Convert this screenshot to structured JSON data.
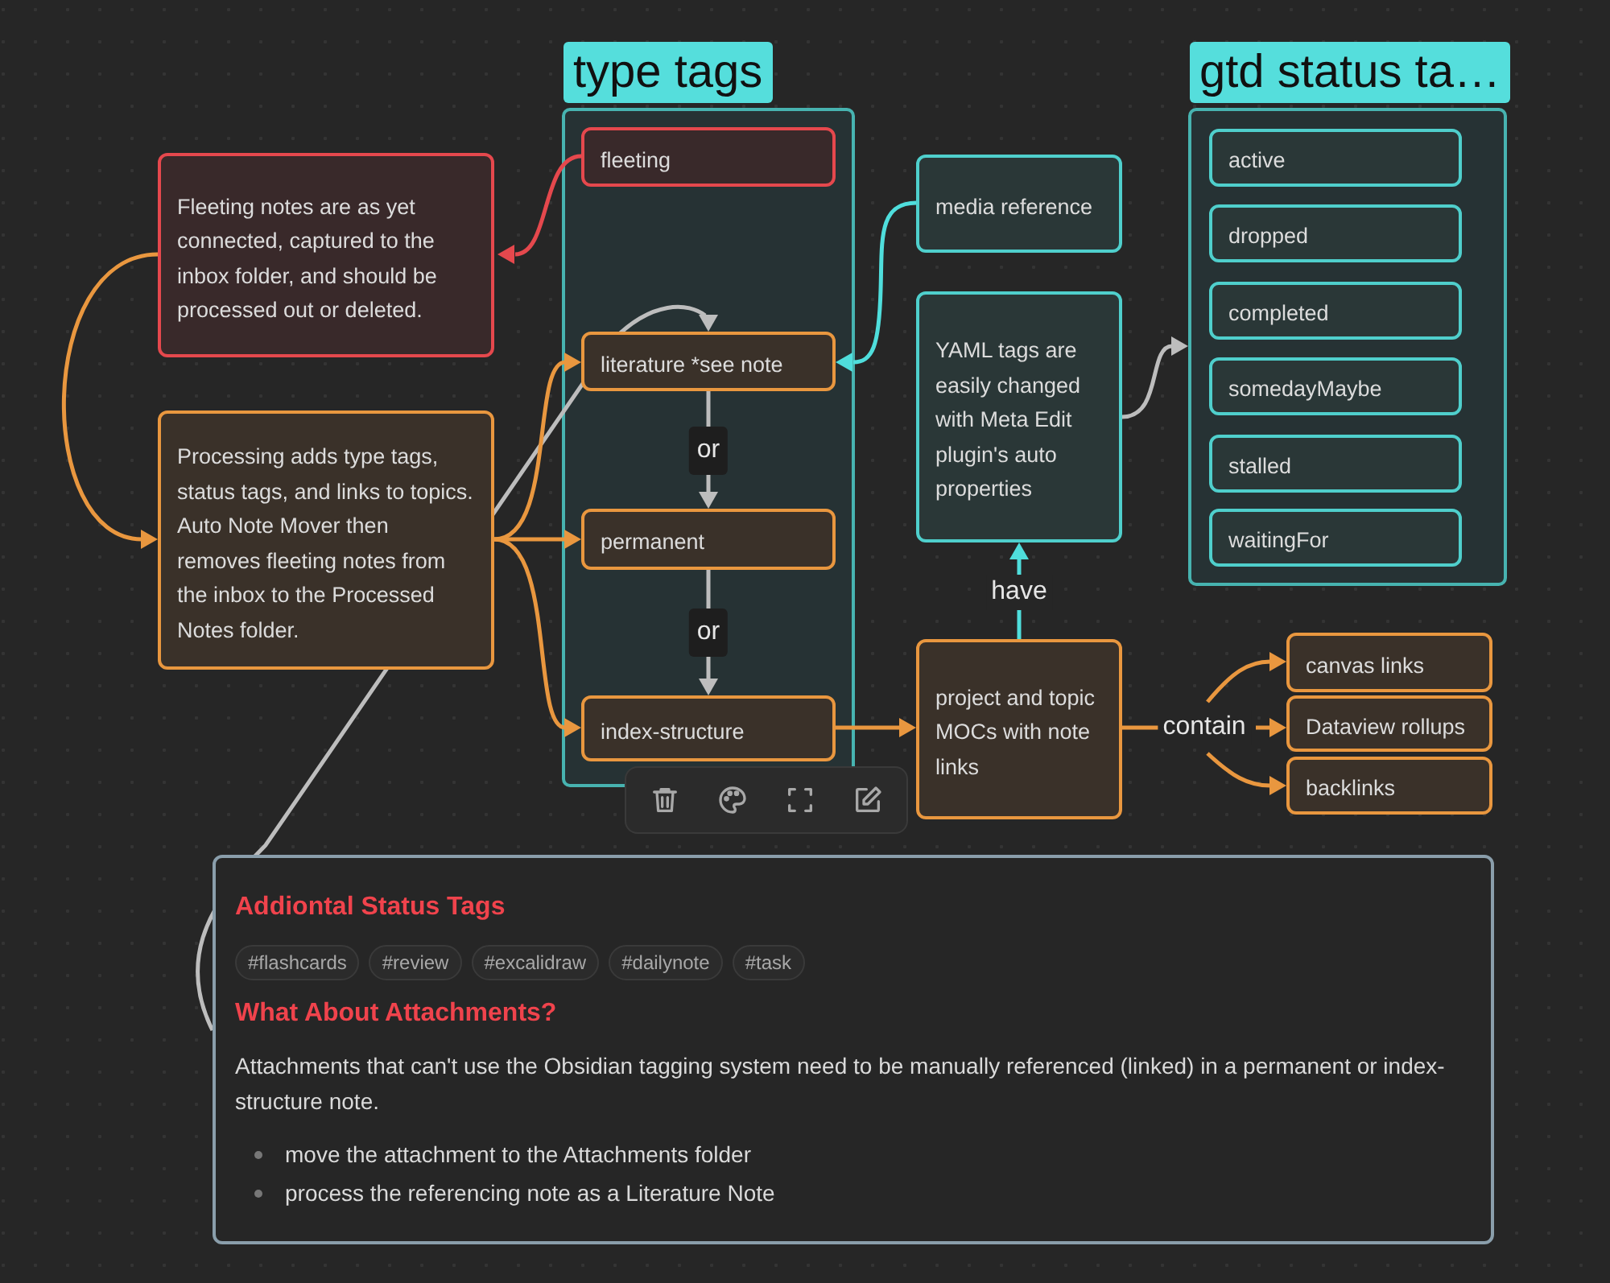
{
  "groups": [
    {
      "label": "type tags"
    },
    {
      "label": "gtd status ta…"
    }
  ],
  "nodes": [
    {
      "text": "fleeting",
      "color": "#e5484d"
    },
    {
      "text": "Fleeting notes are as yet connected, captured to the inbox folder, and should be processed out or deleted.",
      "color": "#e5484d"
    },
    {
      "text": "literature *see note",
      "color": "#e9973f"
    },
    {
      "text": "Processing adds type tags, status tags, and links to topics. Auto Note Mover then removes fleeting notes from the inbox to the Processed Notes folder.",
      "color": "#e9973f"
    },
    {
      "text": "permanent",
      "color": "#e9973f"
    },
    {
      "text": "index-structure",
      "color": "#e9973f"
    },
    {
      "text": "media reference",
      "color": "#4fcfcc"
    },
    {
      "text": "YAML tags are easily changed with Meta Edit plugin's auto properties",
      "color": "#4fcfcc"
    },
    {
      "text": "project and topic MOCs with note links",
      "color": "#e9973f"
    },
    {
      "text": "canvas links",
      "color": "#e9973f"
    },
    {
      "text": "Dataview rollups",
      "color": "#e9973f"
    },
    {
      "text": "backlinks",
      "color": "#e9973f"
    },
    {
      "text": "active",
      "color": "#4fcfcc"
    },
    {
      "text": "dropped",
      "color": "#4fcfcc"
    },
    {
      "text": "completed",
      "color": "#4fcfcc"
    },
    {
      "text": "somedayMaybe",
      "color": "#4fcfcc"
    },
    {
      "text": "stalled",
      "color": "#4fcfcc"
    },
    {
      "text": "waitingFor",
      "color": "#4fcfcc"
    }
  ],
  "edge_labels": [
    "or",
    "or",
    "have",
    "contain"
  ],
  "note": {
    "title": "Addiontal Status Tags",
    "tags": [
      "#flashcards",
      "#review",
      "#excalidraw",
      "#dailynote",
      "#task"
    ],
    "subtitle": "What About Attachments?",
    "paragraph": "Attachments that can't use the Obsidian tagging system need to be manually referenced (linked) in a permanent or index-structure note.",
    "bullets": [
      "move the attachment to the Attachments folder",
      "process the referencing note as a Literature Note"
    ]
  }
}
